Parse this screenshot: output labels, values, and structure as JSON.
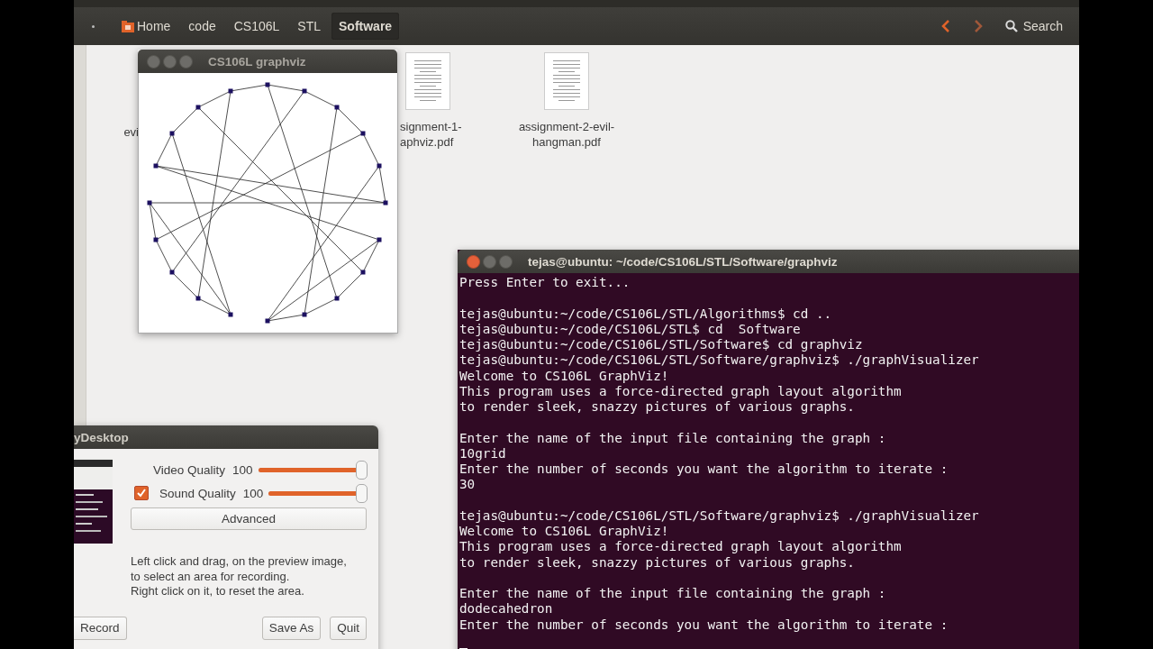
{
  "file_manager": {
    "breadcrumbs": [
      {
        "label": "Home",
        "kind": "home",
        "selected": false
      },
      {
        "label": "code",
        "kind": "plain",
        "selected": false
      },
      {
        "label": "CS106L",
        "kind": "plain",
        "selected": false
      },
      {
        "label": "STL",
        "kind": "plain",
        "selected": false
      },
      {
        "label": "Software",
        "kind": "plain",
        "selected": true
      }
    ],
    "search": "Search",
    "files": [
      {
        "kind": "partial",
        "lines": [
          "evi"
        ]
      },
      {
        "kind": "pdf",
        "lines": [
          "signment-1-",
          "aphviz.pdf"
        ]
      },
      {
        "kind": "pdf",
        "lines": [
          "assignment-2-evil-",
          "hangman.pdf"
        ]
      }
    ]
  },
  "graph_window": {
    "title": "CS106L graphviz"
  },
  "recorder": {
    "title": "yDesktop",
    "sliders": [
      {
        "kind": "plain",
        "label": "Video Quality",
        "reading": "100",
        "level": 1
      },
      {
        "kind": "checkbox",
        "checked": true,
        "label": "Sound Quality",
        "reading": "100",
        "level": 1
      }
    ],
    "advanced": "Advanced",
    "help": [
      "Left click and drag, on the preview image,",
      "to select an area for recording.",
      "Right click on it, to reset the area."
    ],
    "buttons": [
      {
        "label": "Record",
        "kind": "left"
      },
      {
        "label": "Save As",
        "kind": "right"
      },
      {
        "label": "Quit",
        "kind": "right"
      }
    ]
  },
  "terminal": {
    "title": "tejas@ubuntu: ~/code/CS106L/STL/Software/graphviz",
    "blocks": [
      [
        "Press Enter to exit..."
      ],
      [
        "tejas@ubuntu:~/code/CS106L/STL/Algorithms$ cd ..",
        "tejas@ubuntu:~/code/CS106L/STL$ cd  Software",
        "tejas@ubuntu:~/code/CS106L/STL/Software$ cd graphviz",
        "tejas@ubuntu:~/code/CS106L/STL/Software/graphviz$ ./graphVisualizer",
        "Welcome to CS106L GraphViz!",
        "This program uses a force-directed graph layout algorithm",
        "to render sleek, snazzy pictures of various graphs."
      ],
      [
        "Enter the name of the input file containing the graph :",
        "10grid",
        "Enter the number of seconds you want the algorithm to iterate :",
        "30"
      ],
      [
        "tejas@ubuntu:~/code/CS106L/STL/Software/graphviz$ ./graphVisualizer",
        "Welcome to CS106L GraphViz!",
        "This program uses a force-directed graph layout algorithm",
        "to render sleek, snazzy pictures of various graphs."
      ],
      [
        "Enter the name of the input file containing the graph :",
        "dodecahedron",
        "Enter the number of seconds you want the algorithm to iterate :"
      ]
    ]
  }
}
